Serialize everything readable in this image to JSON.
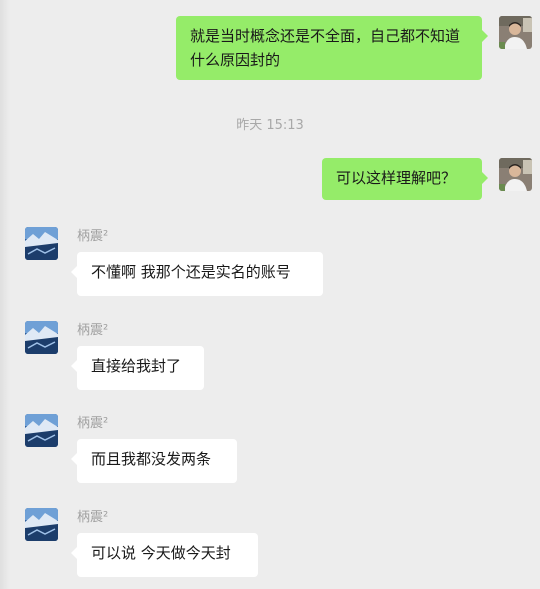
{
  "messages": [
    {
      "from": "me",
      "text": "就是当时概念还是不全面，自己都不知道什么原因封的"
    },
    {
      "from": "me",
      "text": "可以这样理解吧？"
    },
    {
      "from": "contact",
      "sender": "柄震²",
      "text": "不懂啊 我那个还是实名的账号"
    },
    {
      "from": "contact",
      "sender": "柄震²",
      "text": "直接给我封了"
    },
    {
      "from": "contact",
      "sender": "柄震²",
      "text": "而且我都没发两条"
    },
    {
      "from": "contact",
      "sender": "柄震²",
      "text": "可以说 今天做今天封"
    }
  ],
  "timestamp": "昨天 15:13",
  "colors": {
    "background": "#ededed",
    "my_bubble": "#95ec69",
    "their_bubble": "#ffffff",
    "meta_text": "#a0a0a0"
  },
  "icons": {
    "my_avatar": "user-photo-avatar",
    "contact_avatar": "landscape-photo-avatar"
  }
}
